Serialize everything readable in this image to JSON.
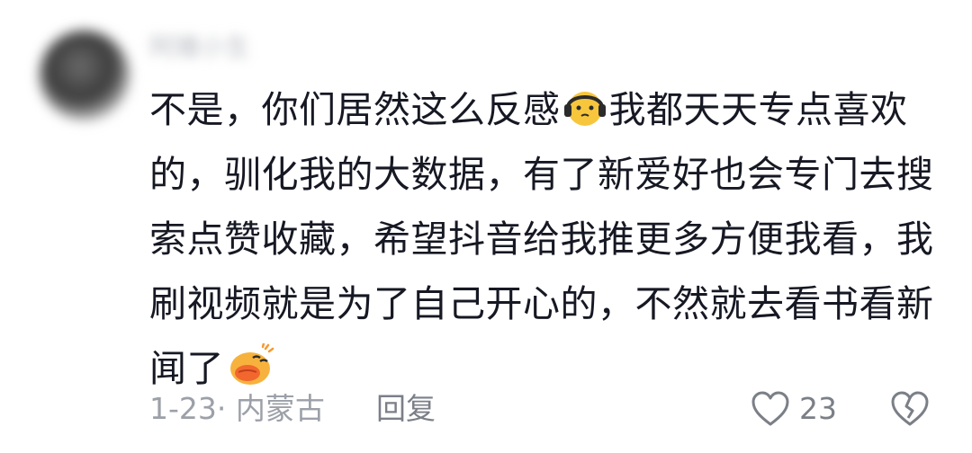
{
  "comment": {
    "username": "阿猪小生",
    "lines": [
      {
        "before_emoji": "不是，你们居然这么反感",
        "emoji": "headphone-face-emoji",
        "after_emoji": "我都天天专点喜欢"
      },
      {
        "text": "的，驯化我的大数据，有了新爱好也会专门去搜"
      },
      {
        "text": "索点赞收藏，希望抖音给我推更多方便我看，我"
      },
      {
        "text": "刷视频就是为了自己开心的，不然就去看书看新"
      },
      {
        "before_emoji": "闻了",
        "emoji": "kissing-face-emoji",
        "after_emoji": ""
      }
    ],
    "date": "1-23",
    "separator": "·",
    "location": "内蒙古",
    "reply_label": "回复",
    "like_count": "23"
  },
  "colors": {
    "text": "#161823",
    "meta": "#9ca0a8",
    "action": "#7b7f87",
    "emoji_yellow": "#f7c63d",
    "emoji_orange": "#f59a2f"
  }
}
